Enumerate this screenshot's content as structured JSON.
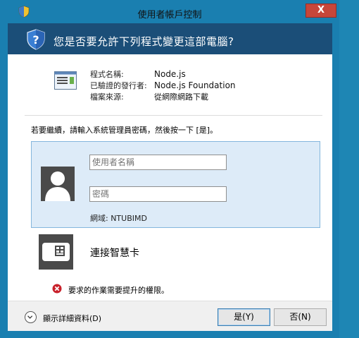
{
  "window": {
    "title": "使用者帳戶控制",
    "close_label": "X",
    "header_question": "您是否要允許下列程式變更這部電腦?"
  },
  "program_info": {
    "rows": [
      {
        "label": "程式名稱:",
        "value": "Node.js"
      },
      {
        "label": "已驗證的發行者:",
        "value": "Node.js Foundation"
      },
      {
        "label": "檔案來源:",
        "value": "從網際網路下載"
      }
    ]
  },
  "credentials": {
    "instruction": "若要繼續，請輸入系統管理員密碼，然後按一下 [是]。",
    "username_placeholder": "使用者名稱",
    "password_placeholder": "密碼",
    "domain": "網域: NTUBIMD"
  },
  "smartcard": {
    "label": "連接智慧卡"
  },
  "error": {
    "message": "要求的作業需要提升的權限。"
  },
  "footer": {
    "details_label": "顯示詳細資料(D)",
    "yes_label": "是(Y)",
    "no_label": "否(N)"
  },
  "colors": {
    "titlebar": "#1a7fb0",
    "header": "#1b4e78",
    "credential_panel": "#ddebf8",
    "close_button": "#c7463a",
    "error": "#c8202a"
  }
}
